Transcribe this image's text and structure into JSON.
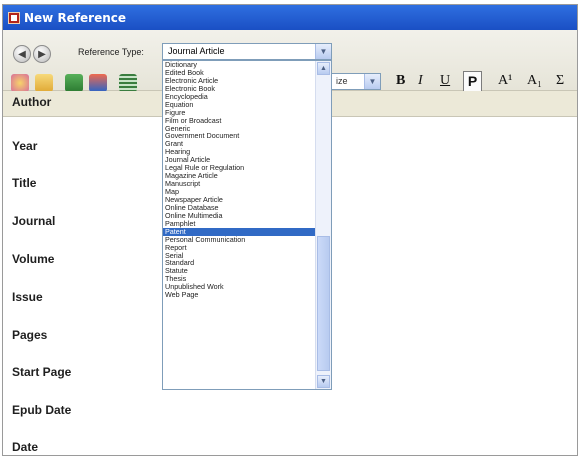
{
  "window": {
    "title": "New Reference"
  },
  "toolbar": {
    "reference_type_label": "Reference Type:",
    "reference_type_value": "Journal Article",
    "font_size_value": "ize",
    "format_bold": "B",
    "format_italic": "I",
    "format_underline": "U",
    "format_plain": "P",
    "format_superscript": "A¹",
    "format_subscript": "A₁",
    "format_symbol": "Σ",
    "icons": [
      "back-icon",
      "forward-icon",
      "palette-icon",
      "folder-icon",
      "checkmark-icon",
      "style-icon",
      "list-icon"
    ]
  },
  "fields": [
    {
      "label": "Author"
    },
    {
      "label": "Year"
    },
    {
      "label": "Title"
    },
    {
      "label": "Journal"
    },
    {
      "label": "Volume"
    },
    {
      "label": "Issue"
    },
    {
      "label": "Pages"
    },
    {
      "label": "Start Page"
    },
    {
      "label": "Epub Date"
    },
    {
      "label": "Date"
    }
  ],
  "dropdown": {
    "selected_index": 21,
    "items": [
      "Dictionary",
      "Edited Book",
      "Electronic Article",
      "Electronic Book",
      "Encyclopedia",
      "Equation",
      "Figure",
      "Film or Broadcast",
      "Generic",
      "Government Document",
      "Grant",
      "Hearing",
      "Journal Article",
      "Legal Rule or Regulation",
      "Magazine Article",
      "Manuscript",
      "Map",
      "Newspaper Article",
      "Online Database",
      "Online Multimedia",
      "Pamphlet",
      "Patent",
      "Personal Communication",
      "Report",
      "Serial",
      "Standard",
      "Statute",
      "Thesis",
      "Unpublished Work",
      "Web Page"
    ]
  }
}
